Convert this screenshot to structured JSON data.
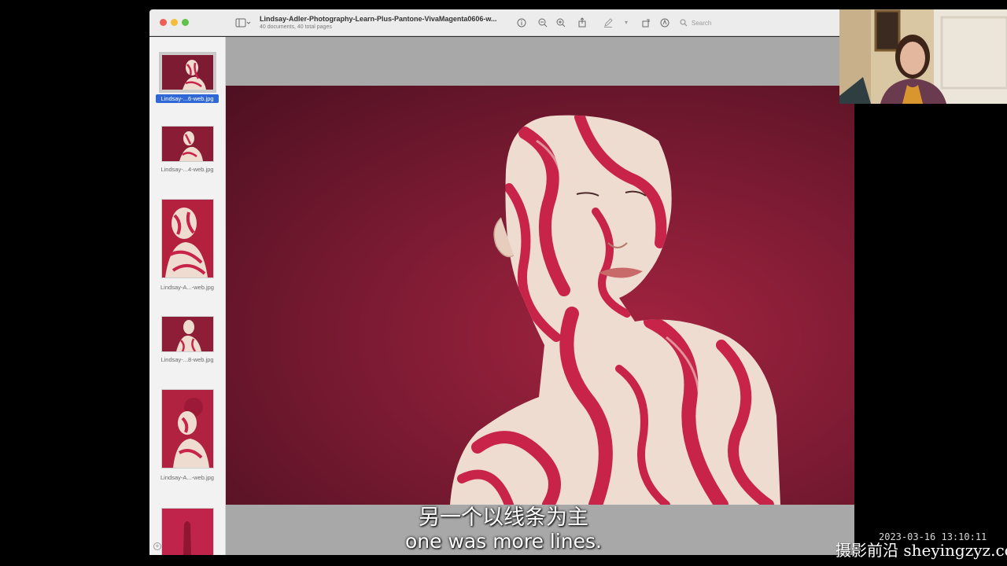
{
  "window": {
    "title": "Lindsay-Adler-Photography-Learn-Plus-Pantone-VivaMagenta0606-w...",
    "subtitle": "40 documents, 40 total pages",
    "search_placeholder": "Search"
  },
  "icons": {
    "sidebar_toggle": "sidebar-icon",
    "info": "info-icon",
    "zoom_out": "zoom-out-icon",
    "zoom_in": "zoom-in-icon",
    "share": "share-icon",
    "markup": "pencil-icon",
    "rotate": "rotate-icon",
    "annotate": "annotate-icon",
    "search": "search-icon"
  },
  "sidebar": {
    "items": [
      {
        "label": "Lindsay-...6-web.jpg",
        "selected": true
      },
      {
        "label": "Lindsay-...4-web.jpg",
        "selected": false
      },
      {
        "label": "Lindsay-A...-web.jpg",
        "selected": false
      },
      {
        "label": "Lindsay-...8-web.jpg",
        "selected": false
      },
      {
        "label": "Lindsay-A...-web.jpg",
        "selected": false
      }
    ]
  },
  "subtitles": {
    "chinese": "另一个以线条为主",
    "english": "one was more lines."
  },
  "timestamp": "2023-03-16  13:10:11",
  "watermark": "摄影前沿 sheyingzyz.com",
  "colors": {
    "accent": "#2f67d6",
    "magenta_bg": "#7d1b33",
    "paint_red": "#c8244a",
    "skin": "#efdcd0"
  }
}
